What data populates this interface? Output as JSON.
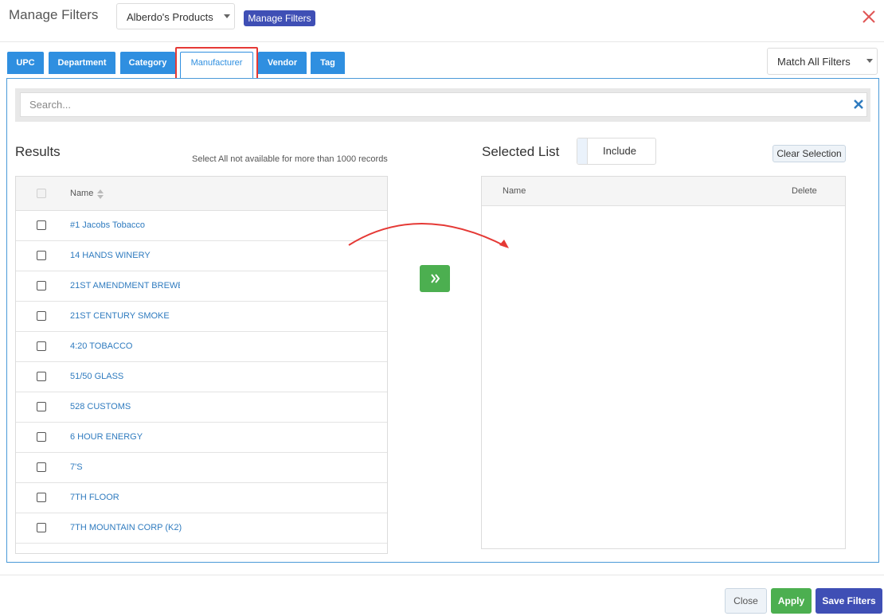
{
  "header": {
    "title": "Manage Filters",
    "product_select": "Alberdo's Products",
    "manage_button": "Manage Filters"
  },
  "tabs": [
    {
      "label": "UPC"
    },
    {
      "label": "Department"
    },
    {
      "label": "Category"
    },
    {
      "label": "Manufacturer"
    },
    {
      "label": "Vendor"
    },
    {
      "label": "Tag"
    }
  ],
  "active_tab": "Manufacturer",
  "match_select": "Match All Filters",
  "search": {
    "placeholder": "Search..."
  },
  "results": {
    "heading": "Results",
    "note": "Select All not available for more than 1000 records",
    "column_name": "Name",
    "items": [
      "#1 Jacobs Tobacco",
      "14 HANDS WINERY",
      "21ST AMENDMENT BREWEI",
      "21ST CENTURY SMOKE",
      "4:20 TOBACCO",
      "51/50 GLASS",
      "528 CUSTOMS",
      "6 HOUR ENERGY",
      "7'S",
      "7TH FLOOR",
      "7TH MOUNTAIN CORP (K2)"
    ]
  },
  "selected": {
    "heading": "Selected List",
    "toggle_label": "Include",
    "clear_button": "Clear Selection",
    "column_name": "Name",
    "column_delete": "Delete"
  },
  "footer": {
    "close": "Close",
    "apply": "Apply",
    "save": "Save Filters"
  },
  "colors": {
    "tab_blue": "#2f8fe0",
    "primary_indigo": "#3f4fb5",
    "success_green": "#4caf50",
    "annotation_red": "#e53935"
  }
}
